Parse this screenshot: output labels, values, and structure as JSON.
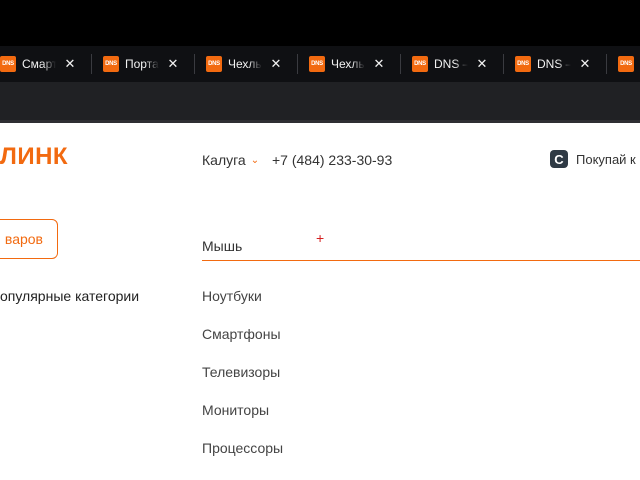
{
  "browser": {
    "tabs": [
      {
        "favicon": "DNS",
        "title": "Смартфоны",
        "close": "✕"
      },
      {
        "favicon": "DNS",
        "title": "Портативные",
        "close": "✕"
      },
      {
        "favicon": "DNS",
        "title": "Чехлы для",
        "close": "✕"
      },
      {
        "favicon": "DNS",
        "title": "Чехлы для",
        "close": "✕"
      },
      {
        "favicon": "DNS",
        "title": "DNS – интернет",
        "close": "✕"
      },
      {
        "favicon": "DNS",
        "title": "DNS – интернет",
        "close": "✕"
      },
      {
        "favicon": "DNS",
        "title": "",
        "close": ""
      }
    ],
    "accent_color": "#f26a10"
  },
  "header": {
    "logo": "ЛИНК",
    "city": "Калуга",
    "chevron": "⌄",
    "phone": "+7 (484) 233-30-93",
    "promo_icon": "С",
    "promo_text": "Покупай к"
  },
  "catalog_button": "варов",
  "search": {
    "value": "Мышь",
    "cursor": "+"
  },
  "sidebar": {
    "popular_label": "опулярные категории"
  },
  "suggestions": [
    "Ноутбуки",
    "Смартфоны",
    "Телевизоры",
    "Мониторы",
    "Процессоры"
  ]
}
